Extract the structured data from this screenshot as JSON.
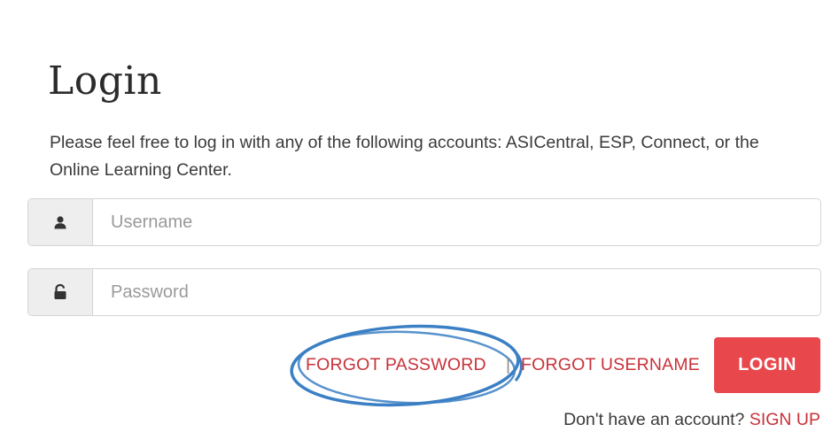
{
  "page": {
    "title": "Login",
    "intro": "Please feel free to log in with any of the following accounts: ASICentral, ESP, Connect, or the Online Learning Center."
  },
  "form": {
    "username": {
      "placeholder": "Username",
      "value": "",
      "icon": "user-icon"
    },
    "password": {
      "placeholder": "Password",
      "value": "",
      "icon": "unlock-icon"
    }
  },
  "actions": {
    "forgot_password": "FORGOT PASSWORD",
    "separator": "|",
    "forgot_username": "FORGOT USERNAME",
    "login": "LOGIN"
  },
  "signup": {
    "prompt": "Don't have an account?",
    "link": "SIGN UP"
  },
  "colors": {
    "accent_red": "#e8474c",
    "link_red": "#c8323a",
    "annotation_blue": "#3b7fc4",
    "addon_bg": "#eeeeee"
  }
}
